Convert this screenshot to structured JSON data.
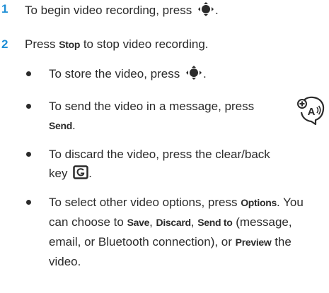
{
  "steps": [
    {
      "number": "1",
      "text": "To begin video recording, press",
      "suffix": "."
    },
    {
      "number": "2",
      "pre": "Press ",
      "key": "Stop",
      "post": " to stop video recording."
    }
  ],
  "bullets": {
    "store": {
      "text": "To store the video, press",
      "suffix": "."
    },
    "send": {
      "line1": "To send the video in a message, press",
      "key": "Send",
      "suffix": "."
    },
    "discard": {
      "line1": "To discard the video, press the clear/back",
      "line2": "key",
      "suffix": "."
    },
    "options": {
      "line1_pre": "To select other video options, press ",
      "line1_key": "Options",
      "line1_post": ". You",
      "line2_pre": "can choose to ",
      "save": "Save",
      "comma1": ", ",
      "discard_key": "Discard",
      "comma2": ", ",
      "send_to": "Send to",
      "line2_post": " (message,",
      "line3_pre": "email, or Bluetooth connection), or ",
      "preview": "Preview",
      "line3_post": " the",
      "line4": "video."
    }
  },
  "icons": {
    "nav": "navigation-key-icon",
    "clear": "clear-back-key-icon",
    "side": "accessibility-feature-icon"
  },
  "colors": {
    "step_number": "#1f8fd6",
    "text": "#2b2b2b"
  }
}
